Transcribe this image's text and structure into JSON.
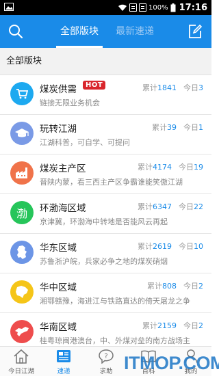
{
  "status_bar": {
    "battery": "100%",
    "time": "17:16"
  },
  "header": {
    "tabs": [
      {
        "label": "全部版块"
      },
      {
        "label": "最新速递"
      }
    ]
  },
  "section_title": "全部版块",
  "total_prefix": "累计",
  "today_prefix": "今日",
  "forums": [
    {
      "title": "煤炭供需",
      "badge": "HOT",
      "subtitle": "链接无限业务机会",
      "total": "1841",
      "today": "3",
      "color": "#1da9f0",
      "icon": "cart-icon"
    },
    {
      "title": "玩转江湖",
      "subtitle": "江湖科普，可自学、可提问",
      "total": "39",
      "today": "1",
      "color": "#7a9ae6",
      "icon": "graduation-cap-icon"
    },
    {
      "title": "煤炭主产区",
      "subtitle": "晋陕内蒙，看三西主产区争霸谁能笑傲江湖",
      "total": "4174",
      "today": "19",
      "color": "#f0734a",
      "icon": "factory-icon"
    },
    {
      "title": "环渤海区域",
      "subtitle": "京津冀，环渤海中转地是否能风云再起",
      "total": "6347",
      "today": "22",
      "color": "#26c55a",
      "icon": "bohai-char-icon",
      "glyph": "渤"
    },
    {
      "title": "华东区域",
      "subtitle": "苏鲁浙沪皖，兵家必争之地的煤炭硝烟",
      "total": "2619",
      "today": "10",
      "color": "#6c95e6",
      "icon": "east-china-map-icon"
    },
    {
      "title": "华中区域",
      "subtitle": "湘鄂赣豫，海进江与铁路直达的倚天屠龙之争",
      "total": "808",
      "today": "2",
      "color": "#f5c518",
      "icon": "central-china-map-icon"
    },
    {
      "title": "华南区域",
      "subtitle": "桂粤琼闽港澳台，中、外煤对垒的南方战场主",
      "total": "2159",
      "today": "2",
      "color": "#ee4d4d",
      "icon": "south-china-map-icon"
    }
  ],
  "tabbar": [
    {
      "label": "今日江湖",
      "icon": "home-icon"
    },
    {
      "label": "速递",
      "icon": "news-icon"
    },
    {
      "label": "求助",
      "icon": "help-icon"
    },
    {
      "label": "百科",
      "icon": "book-icon"
    },
    {
      "label": "我的",
      "icon": "user-icon"
    }
  ],
  "watermark": "ITMOP.COM"
}
